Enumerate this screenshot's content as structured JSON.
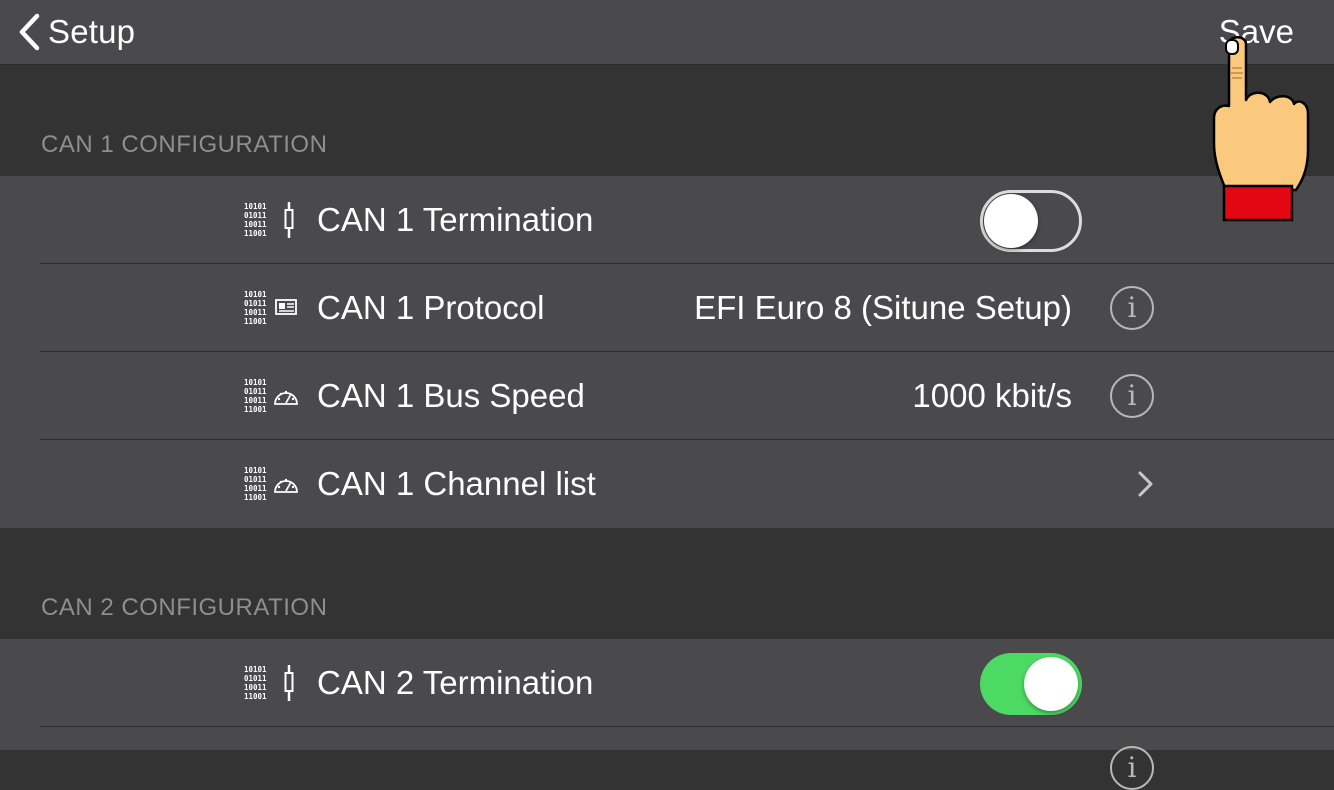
{
  "navbar": {
    "back_label": "Setup",
    "save_label": "Save"
  },
  "sections": [
    {
      "header": "CAN 1 CONFIGURATION",
      "rows": [
        {
          "label": "CAN 1 Termination",
          "icon": "binary-termination-icon",
          "control": "toggle",
          "toggle_on": false
        },
        {
          "label": "CAN 1 Protocol",
          "icon": "binary-protocol-icon",
          "value": "EFI Euro 8 (Situne Setup)",
          "control": "info"
        },
        {
          "label": "CAN 1 Bus Speed",
          "icon": "binary-gauge-icon",
          "value": "1000 kbit/s",
          "control": "info"
        },
        {
          "label": "CAN 1 Channel list",
          "icon": "binary-gauge-icon",
          "control": "chevron"
        }
      ]
    },
    {
      "header": "CAN 2 CONFIGURATION",
      "rows": [
        {
          "label": "CAN 2 Termination",
          "icon": "binary-termination-icon",
          "control": "toggle",
          "toggle_on": true
        }
      ]
    }
  ],
  "colors": {
    "toggle_on": "#4cd964",
    "row_background": "#4a4a4c",
    "page_background": "#333333",
    "section_header_text": "#8e8e8e"
  }
}
